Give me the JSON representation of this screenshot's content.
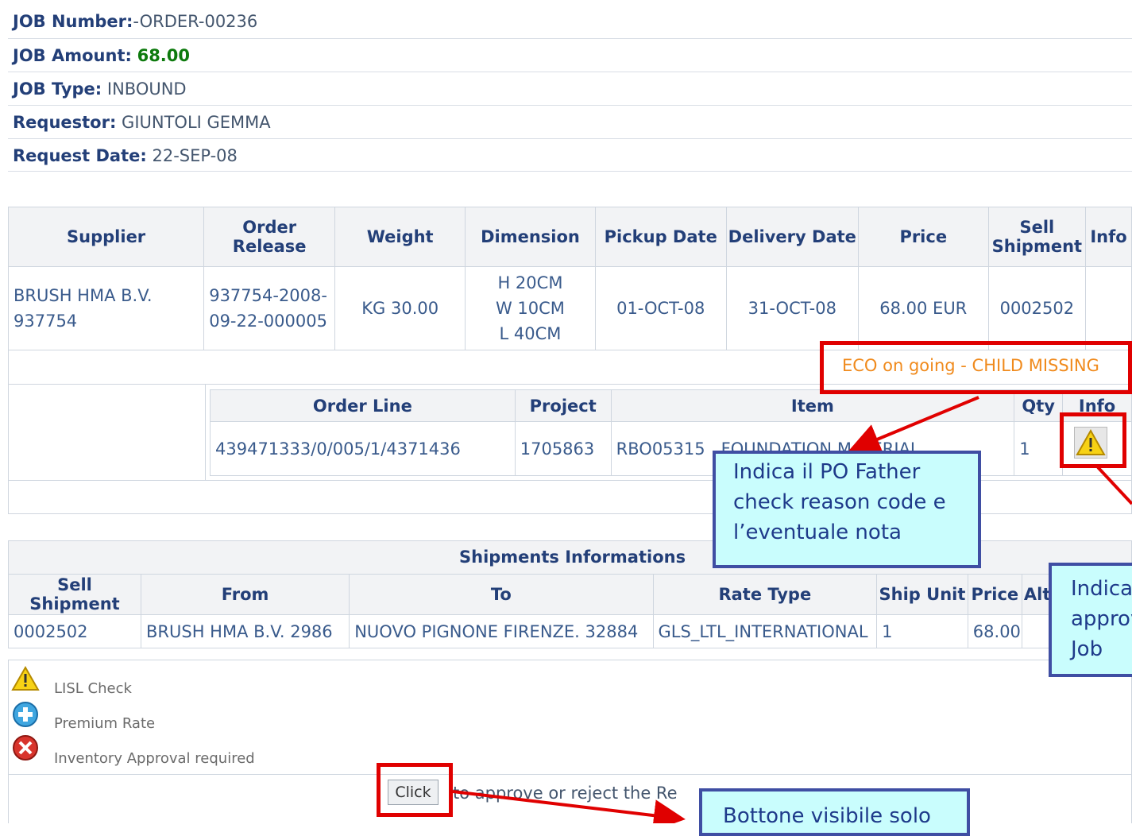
{
  "job": {
    "number_label": "JOB Number:",
    "number_value": "-ORDER-00236",
    "amount_label": "JOB Amount:",
    "amount_value": "68.00",
    "type_label": "JOB Type:",
    "type_value": "INBOUND",
    "requestor_label": "Requestor:",
    "requestor_value": "GIUNTOLI GEMMA",
    "date_label": "Request Date:",
    "date_value": "22-SEP-08"
  },
  "order_table": {
    "headers": [
      "Supplier",
      "Order Release",
      "Weight",
      "Dimension",
      "Pickup Date",
      "Delivery Date",
      "Price",
      "Sell Shipment",
      "Info"
    ],
    "row": {
      "supplier": "BRUSH HMA B.V. 937754",
      "release": "937754-2008-09-22-000005",
      "weight": "KG 30.00",
      "dim_h": "H 20CM",
      "dim_w": "W 10CM",
      "dim_l": "L 40CM",
      "pickup": "01-OCT-08",
      "delivery": "31-OCT-08",
      "price": "68.00 EUR",
      "sell": "0002502"
    },
    "warning": "ECO on going - CHILD MISSING"
  },
  "line_table": {
    "headers": [
      "Order Line",
      "Project",
      "Item",
      "Qty",
      "Info"
    ],
    "row": {
      "order_line": "439471333/0/005/1/4371436",
      "project": "1705863",
      "item_code": "RBO05315",
      "item_desc": "FOUNDATION MATERIAL",
      "qty": "1"
    }
  },
  "shipments": {
    "title": "Shipments Informations",
    "headers": [
      "Sell Shipment",
      "From",
      "To",
      "Rate Type",
      "Ship Unit",
      "Price",
      "Alt"
    ],
    "row": {
      "sell": "0002502",
      "from": "BRUSH HMA B.V. 2986",
      "to": "NUOVO PIGNONE FIRENZE. 32884",
      "rate": "GLS_LTL_INTERNATIONAL",
      "unit": "1",
      "price": "68.00"
    }
  },
  "legend": {
    "lisl": "LISL Check",
    "premium": "Premium Rate",
    "inventory": "Inventory Approval required"
  },
  "action": {
    "button": "Click",
    "text": "to approve or reject the Re"
  },
  "callouts": {
    "po": "Indica il PO Father check reason code e l’eventuale nota",
    "approval": "Indica approv Job co",
    "button_note": "Bottone visibile solo"
  },
  "colors": {
    "annotation_red": "#e00000",
    "callout_bg": "#c9fdfd",
    "callout_border": "#3f4ea3"
  }
}
